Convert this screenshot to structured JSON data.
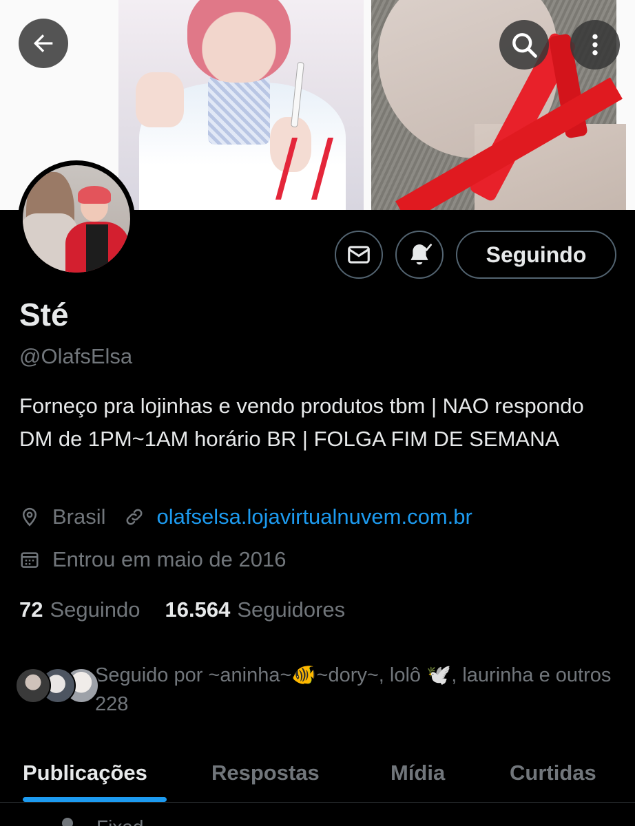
{
  "profile": {
    "display_name": "Sté",
    "handle": "@OlafsElsa",
    "bio": "Forneço pra lojinhas e vendo produtos tbm | NAO respondo DM de 1PM~1AM horário BR | FOLGA FIM DE SEMANA",
    "location": "Brasil",
    "website": "olafselsa.lojavirtualnuvem.com.br",
    "joined": "Entrou em maio de 2016"
  },
  "stats": {
    "following_count": "72",
    "following_label": "Seguindo",
    "followers_count": "16.564",
    "followers_label": "Seguidores"
  },
  "followed_by": {
    "text": "Seguido por ~aninha~🐠~dory~, lolô 🕊️, laurinha e outros 228"
  },
  "actions": {
    "follow_label": "Seguindo"
  },
  "tabs": [
    {
      "label": "Publicações",
      "active": true
    },
    {
      "label": "Respostas",
      "active": false
    },
    {
      "label": "Mídia",
      "active": false
    },
    {
      "label": "Curtidas",
      "active": false
    }
  ],
  "peek": {
    "text": "Fixad"
  },
  "icons": {
    "back": "arrow-left-icon",
    "search": "search-icon",
    "more": "more-vertical-icon",
    "dm": "envelope-icon",
    "notifications": "bell-check-icon",
    "location": "location-pin-icon",
    "link": "link-icon",
    "calendar": "calendar-icon"
  },
  "colors": {
    "background": "#000000",
    "primary_text": "#e7e9ea",
    "secondary_text": "#71767b",
    "accent": "#1d9bf0",
    "border": "#536471"
  }
}
